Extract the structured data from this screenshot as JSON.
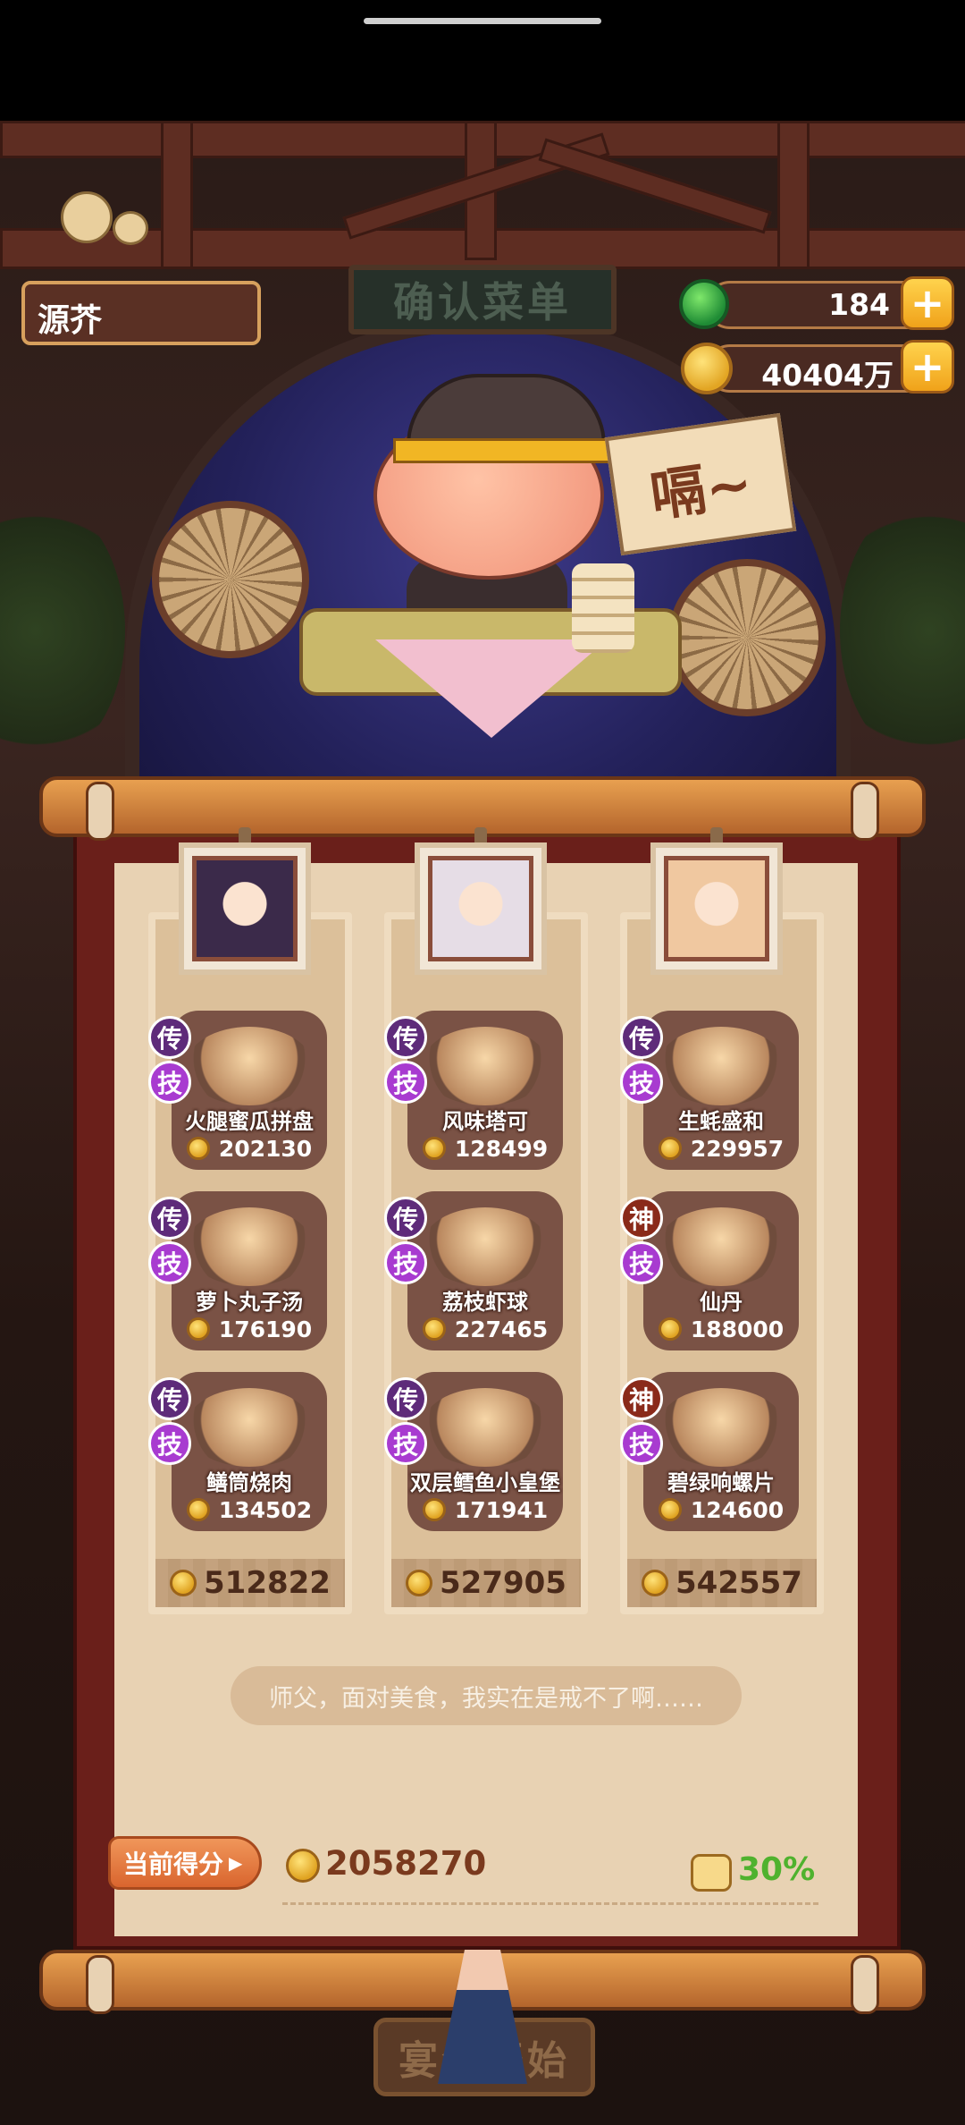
{
  "player": {
    "name": "源芥"
  },
  "header": {
    "title": "确认菜单"
  },
  "currency": {
    "gems": "184",
    "coins": "40404万"
  },
  "scene": {
    "speech": "嗝~"
  },
  "columns": [
    {
      "total": "512822",
      "dishes": [
        {
          "rank": "传",
          "skill": "技",
          "name": "火腿蜜瓜拼盘",
          "price": "202130"
        },
        {
          "rank": "传",
          "skill": "技",
          "name": "萝卜丸子汤",
          "price": "176190"
        },
        {
          "rank": "传",
          "skill": "技",
          "name": "鳝筒烧肉",
          "price": "134502"
        }
      ]
    },
    {
      "total": "527905",
      "dishes": [
        {
          "rank": "传",
          "skill": "技",
          "name": "风味塔可",
          "price": "128499"
        },
        {
          "rank": "传",
          "skill": "技",
          "name": "荔枝虾球",
          "price": "227465"
        },
        {
          "rank": "传",
          "skill": "技",
          "name": "双层鳕鱼小皇堡",
          "price": "171941"
        }
      ]
    },
    {
      "total": "542557",
      "dishes": [
        {
          "rank": "传",
          "skill": "技",
          "name": "生蚝盛和",
          "price": "229957"
        },
        {
          "rank": "神",
          "skill": "技",
          "name": "仙丹",
          "price": "188000"
        },
        {
          "rank": "神",
          "skill": "技",
          "name": "碧绿响螺片",
          "price": "124600"
        }
      ]
    }
  ],
  "hint": "师父，面对美食，我实在是戒不了啊……",
  "score": {
    "label": "当前得分",
    "value": "2058270",
    "bonus": "30%"
  },
  "start_button": {
    "label": "宴会开始"
  },
  "colors": {
    "accent": "#f0a21a",
    "bonus_green": "#4fb22e",
    "legend_badge": "#5e2b7a",
    "god_badge": "#8a2a1a",
    "skill_badge": "#a83bd0"
  }
}
